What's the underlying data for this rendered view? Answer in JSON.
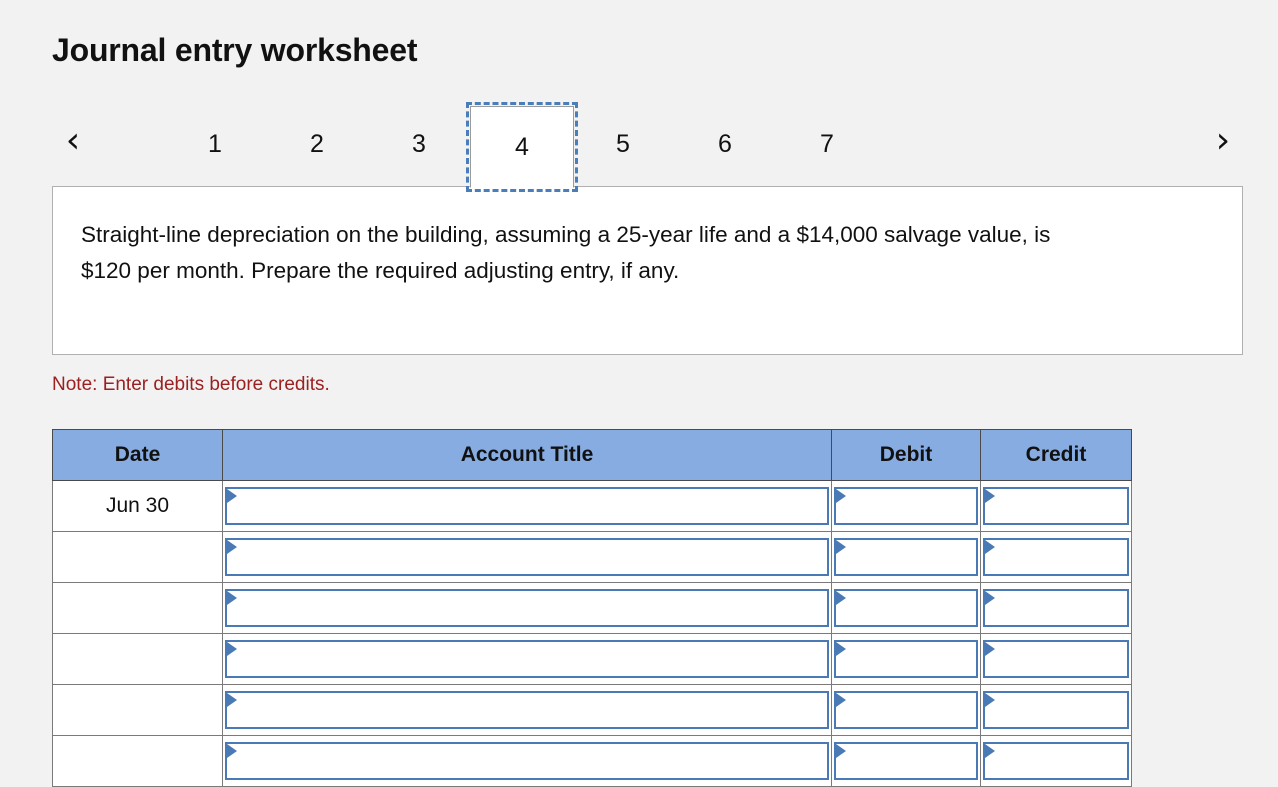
{
  "page": {
    "title": "Journal entry worksheet",
    "background_color": "#f2f2f2"
  },
  "tabbar": {
    "prev_label": "‹",
    "next_label": "›",
    "prev_icon": "chevron-left-icon",
    "next_icon": "chevron-right-icon",
    "active_index": 3,
    "tabs": [
      {
        "label": "1"
      },
      {
        "label": "2"
      },
      {
        "label": "3"
      },
      {
        "label": "4"
      },
      {
        "label": "5"
      },
      {
        "label": "6"
      },
      {
        "label": "7"
      }
    ]
  },
  "question": {
    "text": "Straight-line depreciation on the building, assuming a 25-year life and a $14,000 salvage value, is $120 per month. Prepare the required adjusting entry, if any."
  },
  "note": {
    "text": "Note: Enter debits before credits.",
    "color": "#9c2020"
  },
  "journal": {
    "header_color": "#87ace2",
    "input_border_color": "#4a7ab5",
    "columns": [
      {
        "key": "date",
        "label": "Date"
      },
      {
        "key": "account_title",
        "label": "Account Title"
      },
      {
        "key": "debit",
        "label": "Debit"
      },
      {
        "key": "credit",
        "label": "Credit"
      }
    ],
    "rows": [
      {
        "date": "Jun 30",
        "account_title": "",
        "debit": "",
        "credit": ""
      },
      {
        "date": "",
        "account_title": "",
        "debit": "",
        "credit": ""
      },
      {
        "date": "",
        "account_title": "",
        "debit": "",
        "credit": ""
      },
      {
        "date": "",
        "account_title": "",
        "debit": "",
        "credit": ""
      },
      {
        "date": "",
        "account_title": "",
        "debit": "",
        "credit": ""
      },
      {
        "date": "",
        "account_title": "",
        "debit": "",
        "credit": ""
      }
    ]
  }
}
